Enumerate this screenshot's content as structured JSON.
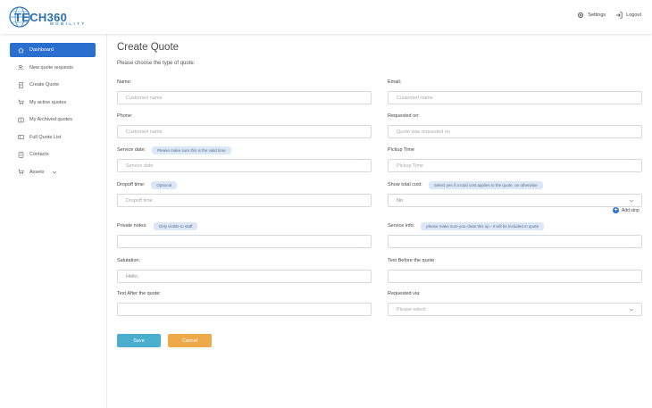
{
  "brand": {
    "name": "TECH360",
    "tagline": "MOBILITY"
  },
  "topbar": {
    "settings_label": "Settings",
    "logout_label": "Logout"
  },
  "sidebar": {
    "items": [
      {
        "label": "Dashboard",
        "icon": "home-icon",
        "active": true
      },
      {
        "label": "New quote requests",
        "icon": "users-icon"
      },
      {
        "label": "Create Quote",
        "icon": "document-icon"
      },
      {
        "label": "My active quotes",
        "icon": "cart-icon"
      },
      {
        "label": "My Archived quotes",
        "icon": "archive-icon"
      },
      {
        "label": "Full Quote List",
        "icon": "list-icon"
      },
      {
        "label": "Contacts",
        "icon": "contacts-icon"
      },
      {
        "label": "Assets",
        "icon": "cart-icon"
      }
    ]
  },
  "page": {
    "title": "Create Quote",
    "subtitle": "Please choose the type of quote:"
  },
  "form": {
    "name": {
      "label": "Name:",
      "placeholder": "Customert name"
    },
    "email": {
      "label": "Email:",
      "placeholder": "Customert name"
    },
    "phone": {
      "label": "Phone:",
      "placeholder": "Customert name"
    },
    "requested_on": {
      "label": "Requested on:",
      "placeholder": "Quote was requested on"
    },
    "service_date": {
      "label": "Service date:",
      "hint": "Please make sure this is the valid time",
      "placeholder": "Service date"
    },
    "pickup_time": {
      "label": "Pickup Time",
      "placeholder": "Pickup Time"
    },
    "dropoff_time": {
      "label": "Dropoff time:",
      "hint": "Optional",
      "placeholder": "Dropoff time"
    },
    "show_total_cost": {
      "label": "Show total cost:",
      "hint": "Select yes if a total cost applies to the quote, on otherwise",
      "value": "No"
    },
    "add_stop_label": "Add stop",
    "private_notes": {
      "label": "Private notes:",
      "hint": "Only visible to staff",
      "value": ""
    },
    "service_info": {
      "label": "Service info:",
      "hint": "please make sure you clean this up - it will be included in quote",
      "value": ""
    },
    "salutation": {
      "label": "Salutation:",
      "value": "Hello,"
    },
    "text_before": {
      "label": "Text Before the quote:",
      "value": ""
    },
    "text_after": {
      "label": "Text After the quote:",
      "value": ""
    },
    "requested_via": {
      "label": "Requested via:",
      "placeholder": "Please select"
    }
  },
  "actions": {
    "save_label": "Save",
    "cancel_label": "Cancel"
  },
  "colors": {
    "primary": "#2a6fce",
    "save": "#4aaecf",
    "cancel": "#eea94a",
    "hint_bg": "#dbe7f6"
  }
}
